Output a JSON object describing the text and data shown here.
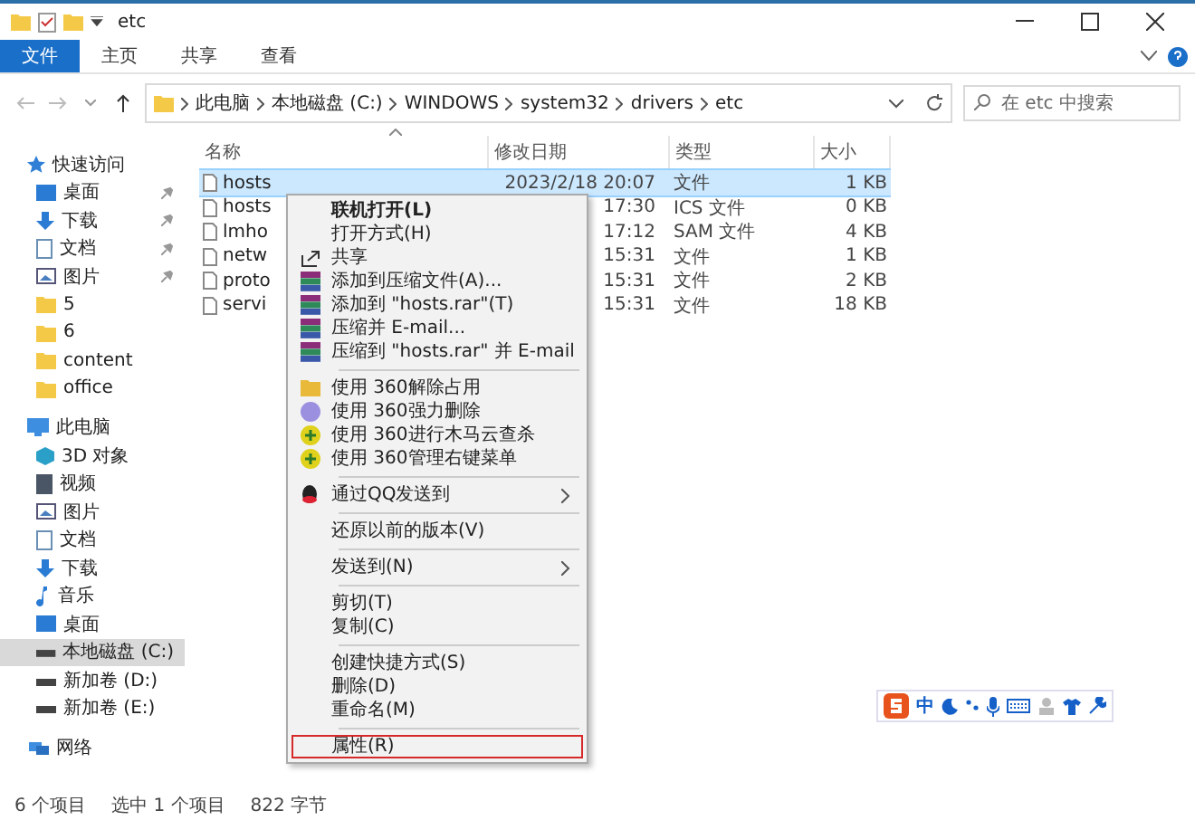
{
  "window": {
    "title": "etc"
  },
  "ribbon": {
    "tabs": [
      {
        "label": "文件",
        "selected": true
      },
      {
        "label": "主页",
        "selected": false
      },
      {
        "label": "共享",
        "selected": false
      },
      {
        "label": "查看",
        "selected": false
      }
    ]
  },
  "address": {
    "crumbs": [
      "此电脑",
      "本地磁盘 (C:)",
      "WINDOWS",
      "system32",
      "drivers",
      "etc"
    ],
    "search_placeholder": "在 etc 中搜索"
  },
  "sidebar": {
    "items": [
      {
        "label": "快速访问",
        "kind": "star",
        "selected": false,
        "children": [
          {
            "label": "桌面",
            "kind": "desktop",
            "pinned": true,
            "selected": false
          },
          {
            "label": "下载",
            "kind": "download",
            "pinned": true,
            "selected": false
          },
          {
            "label": "文档",
            "kind": "doc",
            "pinned": true,
            "selected": false
          },
          {
            "label": "图片",
            "kind": "pic",
            "pinned": true,
            "selected": false
          },
          {
            "label": "5",
            "kind": "folder",
            "pinned": false,
            "selected": false
          },
          {
            "label": "6",
            "kind": "folder",
            "pinned": false,
            "selected": false
          },
          {
            "label": "content",
            "kind": "folder",
            "pinned": false,
            "selected": false
          },
          {
            "label": "office",
            "kind": "folder",
            "pinned": false,
            "selected": false
          }
        ]
      },
      {
        "label": "此电脑",
        "kind": "pc",
        "selected": false,
        "children": [
          {
            "label": "3D 对象",
            "kind": "cube",
            "pinned": false,
            "selected": false
          },
          {
            "label": "视频",
            "kind": "video",
            "pinned": false,
            "selected": false
          },
          {
            "label": "图片",
            "kind": "pic",
            "pinned": false,
            "selected": false
          },
          {
            "label": "文档",
            "kind": "doc",
            "pinned": false,
            "selected": false
          },
          {
            "label": "下载",
            "kind": "download",
            "pinned": false,
            "selected": false
          },
          {
            "label": "音乐",
            "kind": "music",
            "pinned": false,
            "selected": false
          },
          {
            "label": "桌面",
            "kind": "desktop",
            "pinned": false,
            "selected": false
          },
          {
            "label": "本地磁盘 (C:)",
            "kind": "drive",
            "pinned": false,
            "selected": true
          },
          {
            "label": "新加卷 (D:)",
            "kind": "drive",
            "pinned": false,
            "selected": false
          },
          {
            "label": "新加卷 (E:)",
            "kind": "drive",
            "pinned": false,
            "selected": false
          }
        ]
      },
      {
        "label": "网络",
        "kind": "network",
        "selected": false
      }
    ]
  },
  "table": {
    "columns": [
      "名称",
      "修改日期",
      "类型",
      "大小"
    ],
    "rows": [
      {
        "name": "hosts",
        "date": "2023/2/18 20:07",
        "type": "文件",
        "size": "1 KB",
        "selected": true
      },
      {
        "name": "hosts",
        "date": "17:30",
        "type": "ICS 文件",
        "size": "0 KB",
        "selected": false
      },
      {
        "name": "lmho",
        "date": "17:12",
        "type": "SAM 文件",
        "size": "4 KB",
        "selected": false
      },
      {
        "name": "netw",
        "date": "15:31",
        "type": "文件",
        "size": "1 KB",
        "selected": false
      },
      {
        "name": "proto",
        "date": "15:31",
        "type": "文件",
        "size": "2 KB",
        "selected": false
      },
      {
        "name": "servi",
        "date": "15:31",
        "type": "文件",
        "size": "18 KB",
        "selected": false
      }
    ]
  },
  "context_menu": {
    "entries": [
      {
        "kind": "plain",
        "label": "联机打开(L)",
        "default": true,
        "submenu": false,
        "highlighted": false
      },
      {
        "kind": "plain",
        "label": "打开方式(H)",
        "default": false,
        "submenu": false,
        "highlighted": false
      },
      {
        "kind": "share",
        "label": "共享",
        "default": false,
        "submenu": false,
        "highlighted": false
      },
      {
        "kind": "archive",
        "label": "添加到压缩文件(A)...",
        "default": false,
        "submenu": false,
        "highlighted": false
      },
      {
        "kind": "archive",
        "label": "添加到 \"hosts.rar\"(T)",
        "default": false,
        "submenu": false,
        "highlighted": false
      },
      {
        "kind": "archive",
        "label": "压缩并 E-mail...",
        "default": false,
        "submenu": false,
        "highlighted": false
      },
      {
        "kind": "archive",
        "label": "压缩到 \"hosts.rar\" 并 E-mail",
        "default": false,
        "submenu": false,
        "highlighted": false
      },
      {
        "kind": "separator"
      },
      {
        "kind": "unlock",
        "label": "使用 360解除占用",
        "default": false,
        "submenu": false,
        "highlighted": false
      },
      {
        "kind": "shred",
        "label": "使用 360强力删除",
        "default": false,
        "submenu": false,
        "highlighted": false
      },
      {
        "kind": "scan",
        "label": "使用 360进行木马云查杀",
        "default": false,
        "submenu": false,
        "highlighted": false
      },
      {
        "kind": "scan",
        "label": "使用 360管理右键菜单",
        "default": false,
        "submenu": false,
        "highlighted": false
      },
      {
        "kind": "separator"
      },
      {
        "kind": "qq",
        "label": "通过QQ发送到",
        "default": false,
        "submenu": true,
        "highlighted": false
      },
      {
        "kind": "separator"
      },
      {
        "kind": "plain",
        "label": "还原以前的版本(V)",
        "default": false,
        "submenu": false,
        "highlighted": false
      },
      {
        "kind": "separator"
      },
      {
        "kind": "plain",
        "label": "发送到(N)",
        "default": false,
        "submenu": true,
        "highlighted": false
      },
      {
        "kind": "separator"
      },
      {
        "kind": "plain",
        "label": "剪切(T)",
        "default": false,
        "submenu": false,
        "highlighted": false
      },
      {
        "kind": "plain",
        "label": "复制(C)",
        "default": false,
        "submenu": false,
        "highlighted": false
      },
      {
        "kind": "separator"
      },
      {
        "kind": "plain",
        "label": "创建快捷方式(S)",
        "default": false,
        "submenu": false,
        "highlighted": false
      },
      {
        "kind": "plain",
        "label": "删除(D)",
        "default": false,
        "submenu": false,
        "highlighted": false
      },
      {
        "kind": "plain",
        "label": "重命名(M)",
        "default": false,
        "submenu": false,
        "highlighted": false
      },
      {
        "kind": "separator"
      },
      {
        "kind": "plain",
        "label": "属性(R)",
        "default": false,
        "submenu": false,
        "highlighted": true
      }
    ]
  },
  "ime_toolbar": {
    "mode": "中"
  },
  "status_bar": [
    "6 个项目",
    "选中 1 个项目",
    "822 字节"
  ]
}
